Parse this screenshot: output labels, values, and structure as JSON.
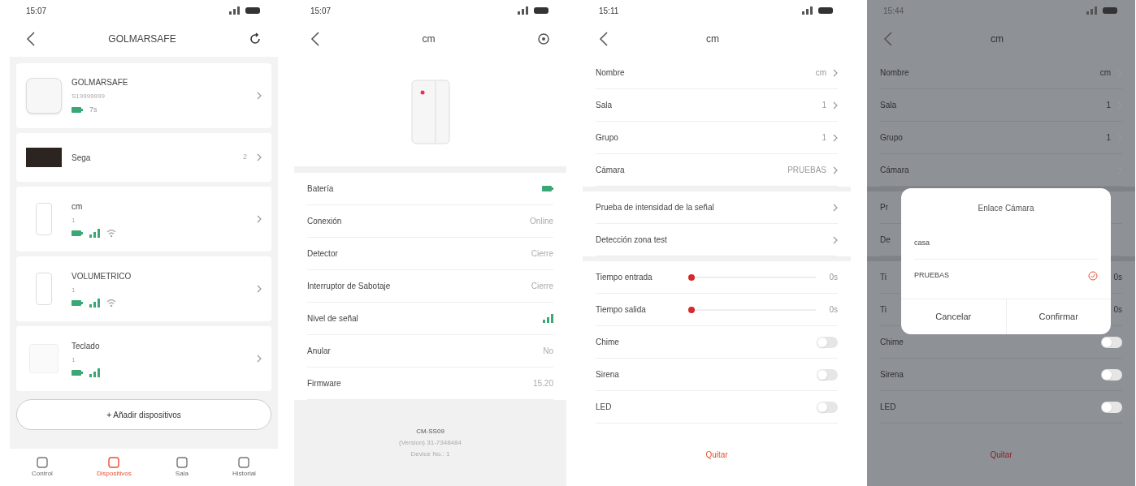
{
  "device_list": {
    "time": "15:07",
    "title": "GOLMARSAFE",
    "devices": [
      {
        "kind": "hub",
        "name": "GOLMARSAFE",
        "subtitle": "S19999999",
        "battery": true,
        "extra": "7s"
      },
      {
        "kind": "panel",
        "name": "Sega",
        "value": "2"
      },
      {
        "kind": "sensor",
        "name": "cm",
        "subtitle": "1",
        "battery": true,
        "signal": true,
        "link": true
      },
      {
        "kind": "sensor",
        "name": "VOLUMETRICO",
        "subtitle": "1",
        "battery": true,
        "signal": true,
        "link": true
      },
      {
        "kind": "keypad",
        "name": "Teclado",
        "subtitle": "1",
        "battery": true,
        "signal": true
      }
    ],
    "add_button": "+ Añadir dispositivos",
    "nav": [
      {
        "label": "Control",
        "selected": false
      },
      {
        "label": "Dispositivos",
        "selected": true
      },
      {
        "label": "Sala",
        "selected": false
      },
      {
        "label": "Historial",
        "selected": false
      }
    ]
  },
  "device_detail": {
    "time": "15:07",
    "title": "cm",
    "rows": [
      {
        "kind": "battery",
        "label": "Batería"
      },
      {
        "kind": "text",
        "label": "Conexión",
        "value": "Online"
      },
      {
        "kind": "text",
        "label": "Detector",
        "value": "Cierre"
      },
      {
        "kind": "text",
        "label": "Interruptor de Sabotaje",
        "value": "Cierre"
      },
      {
        "kind": "signal",
        "label": "Nivel de señal"
      },
      {
        "kind": "text",
        "label": "Anular",
        "value": "No"
      },
      {
        "kind": "text",
        "label": "Firmware",
        "value": "15.20"
      }
    ],
    "footer": [
      "CM-SS09",
      "(Version) 31-7348484",
      "Device No.: 1"
    ]
  },
  "device_settings": {
    "time": "15:11",
    "title": "cm",
    "groups": [
      [
        {
          "kind": "link",
          "label": "Nombre",
          "value": "cm"
        },
        {
          "kind": "link",
          "label": "Sala",
          "value": "1"
        },
        {
          "kind": "link",
          "label": "Grupo",
          "value": "1"
        },
        {
          "kind": "link",
          "label": "Cámara",
          "value": "PRUEBAS"
        }
      ],
      [
        {
          "kind": "link",
          "label": "Prueba de intensidad de la señal"
        },
        {
          "kind": "link",
          "label": "Detección zona test"
        }
      ],
      [
        {
          "kind": "slider",
          "label": "Tiempo entrada",
          "level": 0,
          "value": "0s"
        },
        {
          "kind": "slider",
          "label": "Tiempo salida",
          "level": 0,
          "value": "0s"
        },
        {
          "kind": "toggle",
          "label": "Chime",
          "on": false
        },
        {
          "kind": "toggle",
          "label": "Sirena",
          "on": false
        },
        {
          "kind": "toggle",
          "label": "LED",
          "on": false
        }
      ]
    ],
    "remove": "Quitar"
  },
  "camera_screen": {
    "time": "15:44",
    "title": "cm",
    "groups": [
      [
        {
          "kind": "link",
          "label": "Nombre",
          "value": "cm"
        },
        {
          "kind": "link",
          "label": "Sala",
          "value": "1"
        },
        {
          "kind": "link",
          "label": "Grupo",
          "value": "1"
        },
        {
          "kind": "link",
          "label": "Cámara"
        }
      ],
      [
        {
          "kind": "covered",
          "label": "Pr"
        },
        {
          "kind": "covered",
          "label": "De"
        }
      ],
      [
        {
          "kind": "covered",
          "label": "Ti",
          "value": "0s"
        },
        {
          "kind": "covered",
          "label": "Ti",
          "value": "0s"
        },
        {
          "kind": "toggle",
          "label": "Chime",
          "on": false
        },
        {
          "kind": "toggle",
          "label": "Sirena",
          "on": false
        },
        {
          "kind": "toggle",
          "label": "LED",
          "on": false
        }
      ]
    ],
    "remove": "Quitar",
    "dialog": {
      "title": "Enlace Cámara",
      "options": [
        {
          "label": "casa",
          "selected": false
        },
        {
          "label": "PRUEBAS",
          "selected": true
        }
      ],
      "buttons": [
        "Cancelar",
        "Confirmar"
      ]
    }
  }
}
